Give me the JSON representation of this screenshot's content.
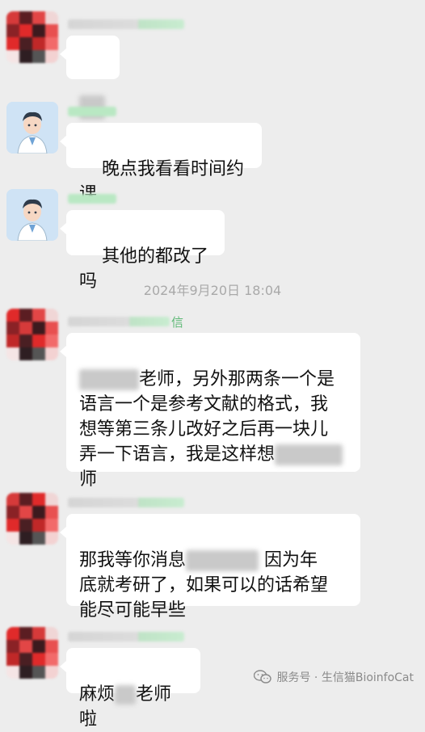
{
  "timestamp": "2024年9月20日 18:04",
  "messages": [
    {
      "text": "",
      "redacted": true
    },
    {
      "text": "晚点我看看时间约课"
    },
    {
      "text": "其他的都改了吗"
    },
    {
      "name_tag": "信",
      "line1_after": "老师，另外那两条一个是",
      "line2": "语言一个是参考文献的格式，我",
      "line3": "想等第三条儿改好之后再一块儿",
      "line4_before": "弄一下语言，我是这样想",
      "line5": "师"
    },
    {
      "line1_before": "那我等你消息",
      "line1_after": "因为年",
      "line2": "底就考研了，如果可以的话希望",
      "line3": "能尽可能早些"
    },
    {
      "before": "麻烦",
      "after": "老师啦"
    }
  ],
  "watermark": "服务号 · 生信猫BioinfoCat",
  "colors": {
    "background": "#ededed",
    "bubble": "#ffffff",
    "name_green": "#5cb874",
    "avatar_red": "#e02a2a"
  }
}
